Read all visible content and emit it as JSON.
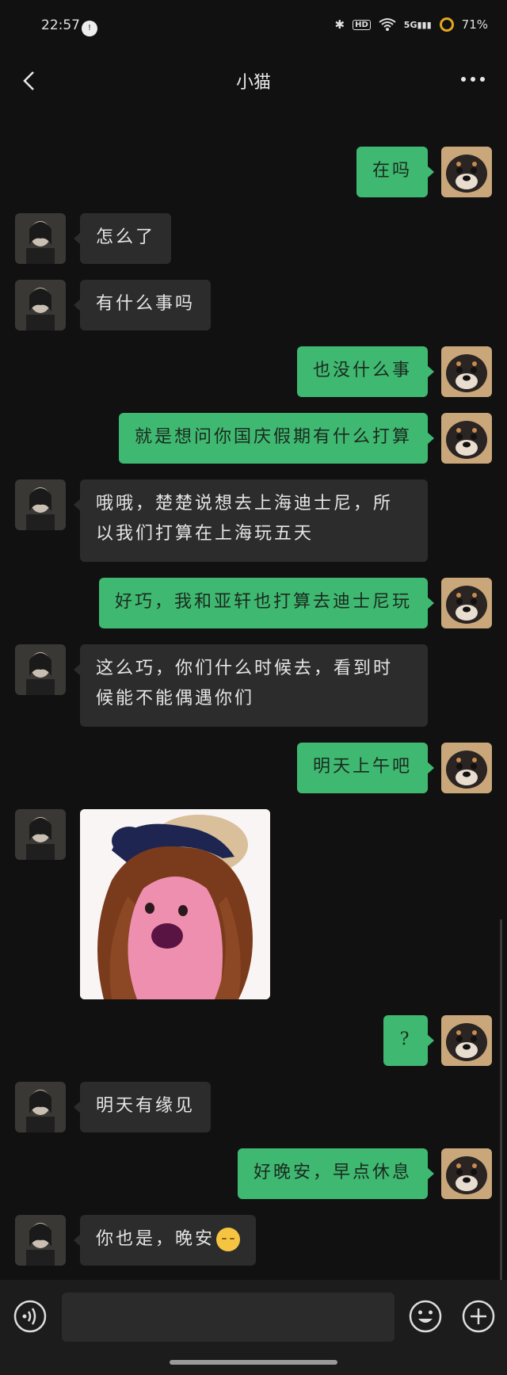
{
  "status": {
    "time": "22:57",
    "notif": "!",
    "hd": "HD",
    "net": "5G",
    "battery": "71%"
  },
  "header": {
    "title": "小猫"
  },
  "messages": [
    {
      "from": "me",
      "text": "在吗"
    },
    {
      "from": "them",
      "text": "怎么了"
    },
    {
      "from": "them",
      "text": "有什么事吗"
    },
    {
      "from": "me",
      "text": "也没什么事"
    },
    {
      "from": "me",
      "text": "就是想问你国庆假期有什么打算"
    },
    {
      "from": "them",
      "text": "哦哦，楚楚说想去上海迪士尼，所以我们打算在上海玩五天"
    },
    {
      "from": "me",
      "text": "好巧，我和亚轩也打算去迪士尼玩"
    },
    {
      "from": "them",
      "text": "这么巧，你们什么时候去，看到时候能不能偶遇你们"
    },
    {
      "from": "me",
      "text": "明天上午吧"
    },
    {
      "from": "them",
      "type": "sticker",
      "text": ""
    },
    {
      "from": "me",
      "text": "?"
    },
    {
      "from": "them",
      "text": "明天有缘见"
    },
    {
      "from": "me",
      "text": "好晚安，早点休息"
    },
    {
      "from": "them",
      "text": "你也是，晚安",
      "emoji": "sleeping-face-icon"
    }
  ],
  "icons": {
    "me_avatar": "dog-avatar",
    "them_avatar": "person-avatar"
  },
  "colors": {
    "bg": "#111111",
    "me_bubble": "#3fb871",
    "them_bubble": "#2c2c2c"
  }
}
